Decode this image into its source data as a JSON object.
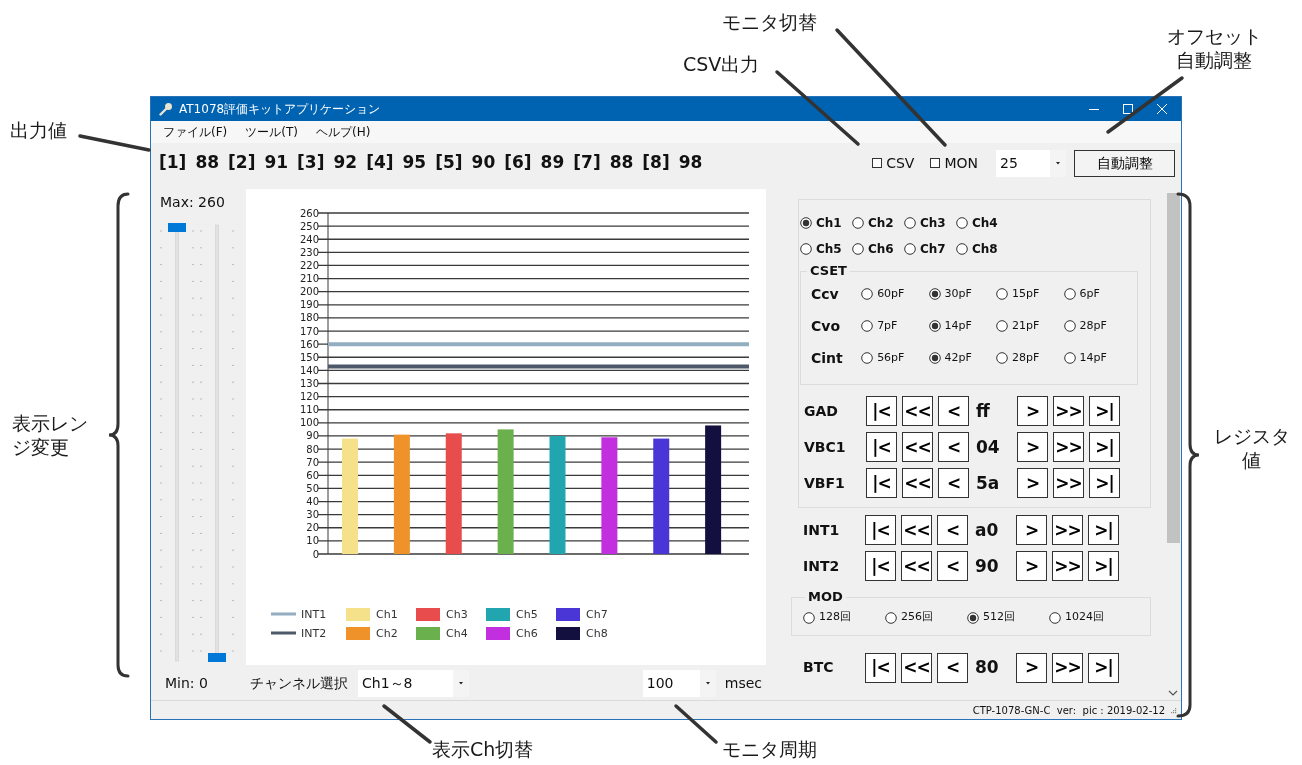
{
  "window": {
    "title": "AT1078評価キットアプリケーション"
  },
  "menu": [
    {
      "label": "ファイル(F)"
    },
    {
      "label": "ツール(T)"
    },
    {
      "label": "ヘルプ(H)"
    }
  ],
  "outputs": [
    {
      "index": "[1]",
      "value": "88"
    },
    {
      "index": "[2]",
      "value": "91"
    },
    {
      "index": "[3]",
      "value": "92"
    },
    {
      "index": "[4]",
      "value": "95"
    },
    {
      "index": "[5]",
      "value": "90"
    },
    {
      "index": "[6]",
      "value": "89"
    },
    {
      "index": "[7]",
      "value": "88"
    },
    {
      "index": "[8]",
      "value": "98"
    }
  ],
  "toolbar": {
    "checkboxes": [
      {
        "label": "CSV",
        "checked": false
      },
      {
        "label": "MON",
        "checked": false
      }
    ],
    "offset": {
      "value": "25"
    },
    "auto_button": "自動調整"
  },
  "range": {
    "max_label": "Max: 260",
    "min_label": "Min: 0",
    "sliders": [
      {
        "level": 1
      },
      {
        "level": 0
      }
    ]
  },
  "chart": {
    "chart_data": {
      "type": "bar",
      "ylim": [
        0,
        260
      ],
      "yticks": [
        0,
        10,
        20,
        30,
        40,
        50,
        60,
        70,
        80,
        90,
        100,
        110,
        120,
        130,
        140,
        150,
        160,
        170,
        180,
        190,
        200,
        210,
        220,
        230,
        240,
        250,
        260
      ],
      "grid": true,
      "legend": "bottom",
      "ref_lines": [
        {
          "label": "INT1",
          "axis": "y",
          "value": 160,
          "color": "#93adc1"
        },
        {
          "label": "INT2",
          "axis": "y",
          "value": 143,
          "color": "#4d5868"
        }
      ],
      "series": [
        {
          "name": "Ch1",
          "color": "#f5e18a",
          "values": [
            88,
            null,
            null,
            null,
            null,
            null,
            null,
            null
          ]
        },
        {
          "name": "Ch2",
          "color": "#f0922a",
          "values": [
            null,
            91,
            null,
            null,
            null,
            null,
            null,
            null
          ]
        },
        {
          "name": "Ch3",
          "color": "#e84c4c",
          "values": [
            null,
            null,
            92,
            null,
            null,
            null,
            null,
            null
          ]
        },
        {
          "name": "Ch4",
          "color": "#6ab04c",
          "values": [
            null,
            null,
            null,
            95,
            null,
            null,
            null,
            null
          ]
        },
        {
          "name": "Ch5",
          "color": "#21a6b0",
          "values": [
            null,
            null,
            null,
            null,
            90,
            null,
            null,
            null
          ]
        },
        {
          "name": "Ch6",
          "color": "#c22fde",
          "values": [
            null,
            null,
            null,
            null,
            null,
            89,
            null,
            null
          ]
        },
        {
          "name": "Ch7",
          "color": "#4a35d6",
          "values": [
            null,
            null,
            null,
            null,
            null,
            null,
            88,
            null
          ]
        },
        {
          "name": "Ch8",
          "color": "#130f3f",
          "values": [
            null,
            null,
            null,
            null,
            null,
            null,
            null,
            98
          ]
        }
      ]
    }
  },
  "channel_select": {
    "label": "チャンネル選択",
    "value": "Ch1～8"
  },
  "period": {
    "value": "100",
    "unit": "msec"
  },
  "channels": [
    {
      "label": "Ch1",
      "selected": true
    },
    {
      "label": "Ch2",
      "selected": false
    },
    {
      "label": "Ch3",
      "selected": false
    },
    {
      "label": "Ch4",
      "selected": false
    },
    {
      "label": "Ch5",
      "selected": false
    },
    {
      "label": "Ch6",
      "selected": false
    },
    {
      "label": "Ch7",
      "selected": false
    },
    {
      "label": "Ch8",
      "selected": false
    }
  ],
  "cset": {
    "title": "CSET",
    "rows": [
      {
        "label": "Ccv",
        "options": [
          {
            "label": "60pF",
            "selected": false
          },
          {
            "label": "30pF",
            "selected": true
          },
          {
            "label": "15pF",
            "selected": false
          },
          {
            "label": "6pF",
            "selected": false
          }
        ]
      },
      {
        "label": "Cvo",
        "options": [
          {
            "label": "7pF",
            "selected": false
          },
          {
            "label": "14pF",
            "selected": true
          },
          {
            "label": "21pF",
            "selected": false
          },
          {
            "label": "28pF",
            "selected": false
          }
        ]
      },
      {
        "label": "Cint",
        "options": [
          {
            "label": "56pF",
            "selected": false
          },
          {
            "label": "42pF",
            "selected": true
          },
          {
            "label": "28pF",
            "selected": false
          },
          {
            "label": "14pF",
            "selected": false
          }
        ]
      }
    ]
  },
  "registers_group": [
    {
      "label": "GAD",
      "value": "ff",
      "buttons": [
        "|<",
        "<<",
        "<",
        ">",
        ">>",
        ">|"
      ]
    },
    {
      "label": "VBC1",
      "value": "04",
      "buttons": [
        "|<",
        "<<",
        "<",
        ">",
        ">>",
        ">|"
      ]
    },
    {
      "label": "VBF1",
      "value": "5a",
      "buttons": [
        "|<",
        "<<",
        "<",
        ">",
        ">>",
        ">|"
      ]
    }
  ],
  "registers": [
    {
      "label": "INT1",
      "value": "a0",
      "buttons": [
        "|<",
        "<<",
        "<",
        ">",
        ">>",
        ">|"
      ]
    },
    {
      "label": "INT2",
      "value": "90",
      "buttons": [
        "|<",
        "<<",
        "<",
        ">",
        ">>",
        ">|"
      ]
    }
  ],
  "mod": {
    "title": "MOD",
    "options": [
      {
        "label": "128回",
        "selected": false
      },
      {
        "label": "256回",
        "selected": false
      },
      {
        "label": "512回",
        "selected": true
      },
      {
        "label": "1024回",
        "selected": false
      }
    ]
  },
  "registers_lower": [
    {
      "label": "BTC",
      "value": "80",
      "buttons": [
        "|<",
        "<<",
        "<",
        ">",
        ">>",
        ">|"
      ]
    }
  ],
  "status_bar": {
    "text": "CTP-1078-GN-C  ver:  pic : 2019-02-12"
  },
  "callouts": [
    {
      "text": "出力値"
    },
    {
      "text": "表示レンジ変更"
    },
    {
      "text": "レジスタ値"
    },
    {
      "text": "CSV出力"
    },
    {
      "text": "モニタ切替"
    },
    {
      "text": "オフセット自動調整"
    },
    {
      "text": "表示Ch切替"
    },
    {
      "text": "モニタ周期"
    }
  ]
}
